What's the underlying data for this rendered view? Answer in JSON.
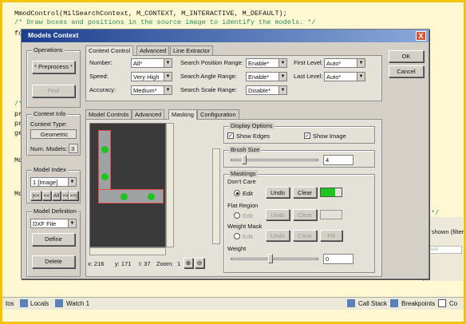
{
  "code": {
    "line1": "MmodControl(MilSearchContext, M_CONTEXT, M_INTERACTIVE, M_DEFAULT);",
    "line2": "/* Draw boxes and positions in the source image to identify the models. */",
    "frag_fo": "fo",
    "frag_pr1": "pr",
    "frag_pr2": "pr",
    "frag_ge": "ge",
    "frag_md1": "Md",
    "frag_md2": "Md",
    "comment_slash": "/*",
    "comment_tail": "*/"
  },
  "dialog": {
    "title": "Models Context",
    "close_glyph": "X",
    "ok": "OK",
    "cancel": "Cancel"
  },
  "operations": {
    "group": "Operations",
    "preprocess": "* Preprocess *",
    "find": "Find"
  },
  "top_tabs": [
    "Context Control",
    "Advanced",
    "Line Extractor"
  ],
  "context_control": {
    "number_label": "Number:",
    "number_value": "All*",
    "speed_label": "Speed:",
    "speed_value": "Very High",
    "accuracy_label": "Accuracy:",
    "accuracy_value": "Medium*",
    "search_position_label": "Search Position Range:",
    "search_position_value": "Enable*",
    "search_angle_label": "Search Angle Range:",
    "search_angle_value": "Enable*",
    "search_scale_label": "Search Scale Range:",
    "search_scale_value": "Disable*",
    "first_level_label": "First Level:",
    "first_level_value": "Auto*",
    "last_level_label": "Last Level:",
    "last_level_value": "Auto*"
  },
  "context_info": {
    "group": "Context Info",
    "type_label": "Context Type:",
    "type_value": "Geometric",
    "num_models_label": "Num. Models:",
    "num_models_value": "3"
  },
  "model_index": {
    "group": "Model Index",
    "value": "1 [Image]",
    "nav_first": "|<<",
    "nav_prev": "<<",
    "nav_all": "All",
    "nav_next": ">>",
    "nav_last": ">>|"
  },
  "model_definition": {
    "group": "Model Definition",
    "value": "DXF File",
    "define": "Define",
    "delete": "Delete"
  },
  "inner_tabs": [
    "Model Controls",
    "Advanced",
    "Masking",
    "Configuration"
  ],
  "image_status": {
    "x": "x: 216",
    "y": "y: 171",
    "value": "I: 37",
    "zoom_label": "Zoom:",
    "zoom_value": "1"
  },
  "display_options": {
    "group": "Display Options",
    "show_edges": "Show Edges",
    "show_image": "Show Image",
    "show_edges_checked": true,
    "show_image_checked": true
  },
  "brush_size": {
    "group": "Brush Size",
    "value": "4",
    "level": 0.15
  },
  "maskings": {
    "group": "Maskings",
    "dont_care": "Don't Care",
    "flat_region": "Flat Region",
    "weight_mask": "Weight Mask",
    "edit": "Edit",
    "undo": "Undo",
    "clear": "Clear",
    "fill": "Fill",
    "color": "#1fc51f",
    "weight_label": "Weight",
    "weight_value": "0",
    "weight_level": 0.45
  },
  "background": {
    "shown_filter": "s shown (filter",
    "task_label": "Task",
    "locals": "Locals",
    "watch": "Watch 1",
    "tos": "tos",
    "call_stack": "Call Stack",
    "breakpoints": "Breakpoints",
    "con": "Co"
  }
}
